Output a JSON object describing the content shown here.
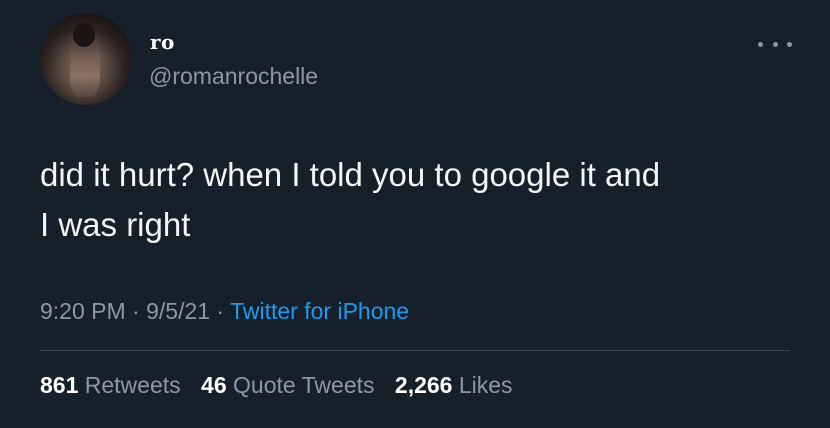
{
  "author": {
    "display_name": "ro",
    "handle": "@romanrochelle",
    "avatar_icon": "profile-photo"
  },
  "more_icon": "more-horizontal-icon",
  "tweet": {
    "text_line1": "did it hurt? when I told you to google it and",
    "text_line2": "I was right"
  },
  "meta": {
    "time": "9:20 PM",
    "sep1": "·",
    "date": "9/5/21",
    "sep2": "·",
    "source": "Twitter for iPhone"
  },
  "stats": {
    "retweets_count": "861",
    "retweets_label": "Retweets",
    "quotes_count": "46",
    "quotes_label": "Quote Tweets",
    "likes_count": "2,266",
    "likes_label": "Likes"
  },
  "colors": {
    "background": "#15202b",
    "secondary_text": "#8b98a5",
    "link": "#1d9bf0"
  }
}
